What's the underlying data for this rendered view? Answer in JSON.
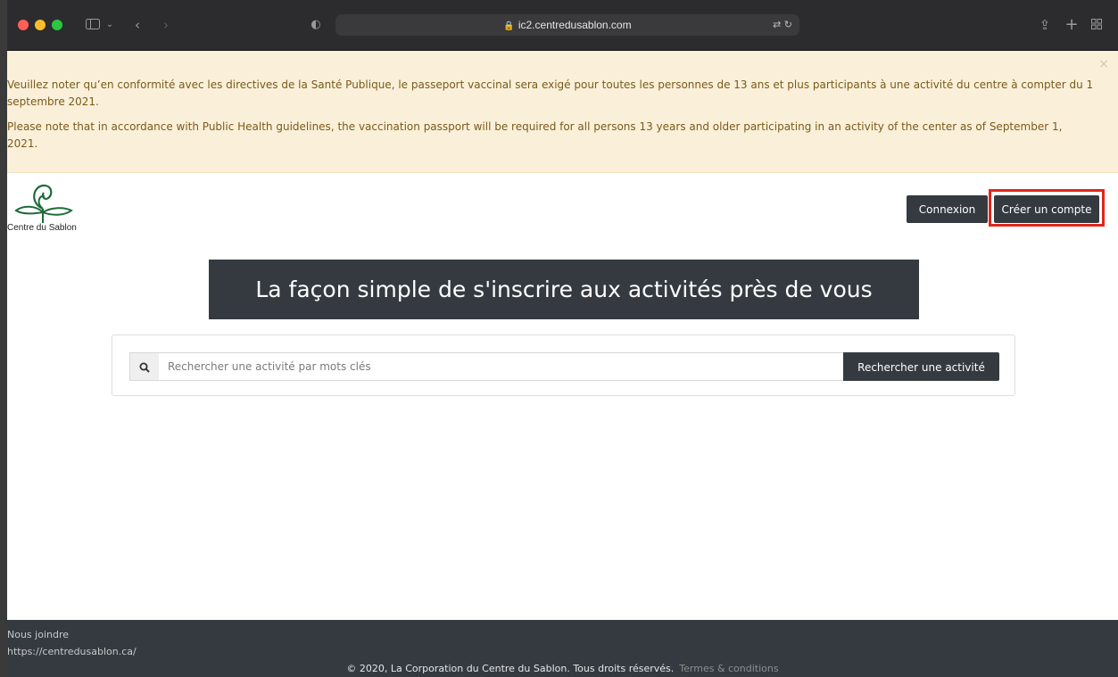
{
  "browser": {
    "url": "ic2.centredusablon.com"
  },
  "alert": {
    "fr": "Veuillez noter qu’en conformité avec les directives de la Santé Publique, le passeport vaccinal sera exigé pour toutes les personnes de 13 ans et plus participants à une activité du centre à compter du 1 septembre 2021.",
    "en": "Please note that in accordance with Public Health guidelines, the vaccination passport will be required for all persons 13 years and older participating in an activity of the center as of September 1, 2021.",
    "close": "×"
  },
  "header": {
    "logo_text": "Centre du Sablon",
    "login_label": "Connexion",
    "create_account_label": "Créer un compte"
  },
  "hero": {
    "title": "La façon simple de s'inscrire aux activités près de vous"
  },
  "search": {
    "placeholder": "Rechercher une activité par mots clés",
    "button_label": "Rechercher une activité"
  },
  "footer": {
    "contact_label": "Nous joindre",
    "contact_url": "https://centredusablon.ca/",
    "copyright": "© 2020, La Corporation du Centre du Sablon. Tous droits réservés.",
    "terms_label": "Termes & conditions"
  },
  "colors": {
    "dark": "#343a40",
    "alert_bg": "#faf0da",
    "alert_text": "#7a5a18",
    "highlight": "#e0261a",
    "logo_green": "#1e6b3a"
  }
}
